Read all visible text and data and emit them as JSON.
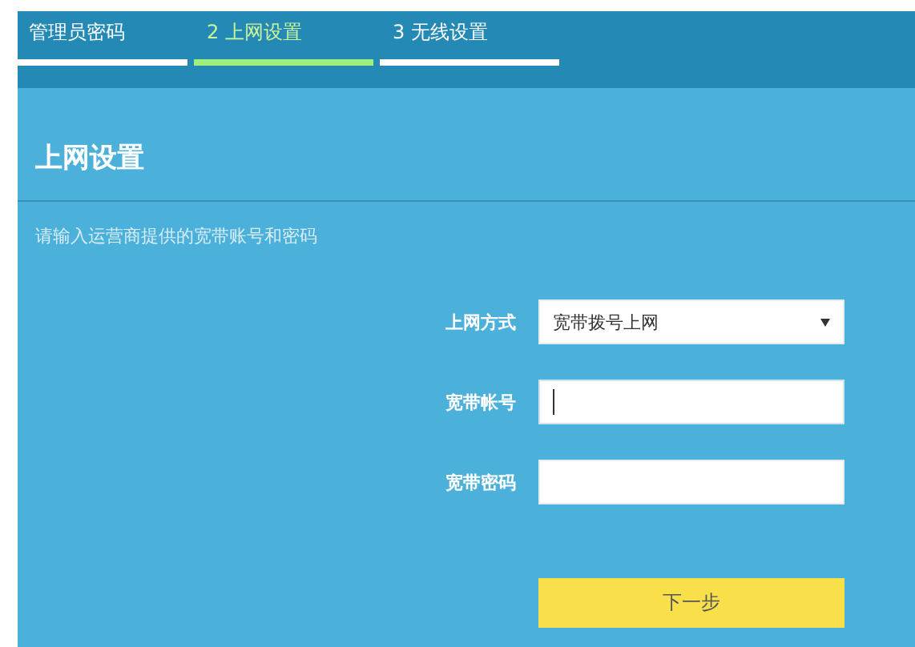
{
  "steps": [
    {
      "label": "管理员密码",
      "selected": false
    },
    {
      "label": "2 上网设置",
      "selected": true
    },
    {
      "label": "3 无线设置",
      "selected": false
    }
  ],
  "title": "上网设置",
  "description": "请输入运营商提供的宽带账号和密码",
  "fields": [
    {
      "kind": "select",
      "label": "上网方式",
      "value": "宽带拨号上网"
    },
    {
      "kind": "text",
      "label": "宽带帐号",
      "focused": true
    },
    {
      "kind": "password",
      "label": "宽带密码",
      "focused": false
    }
  ],
  "next_button": "下一步"
}
